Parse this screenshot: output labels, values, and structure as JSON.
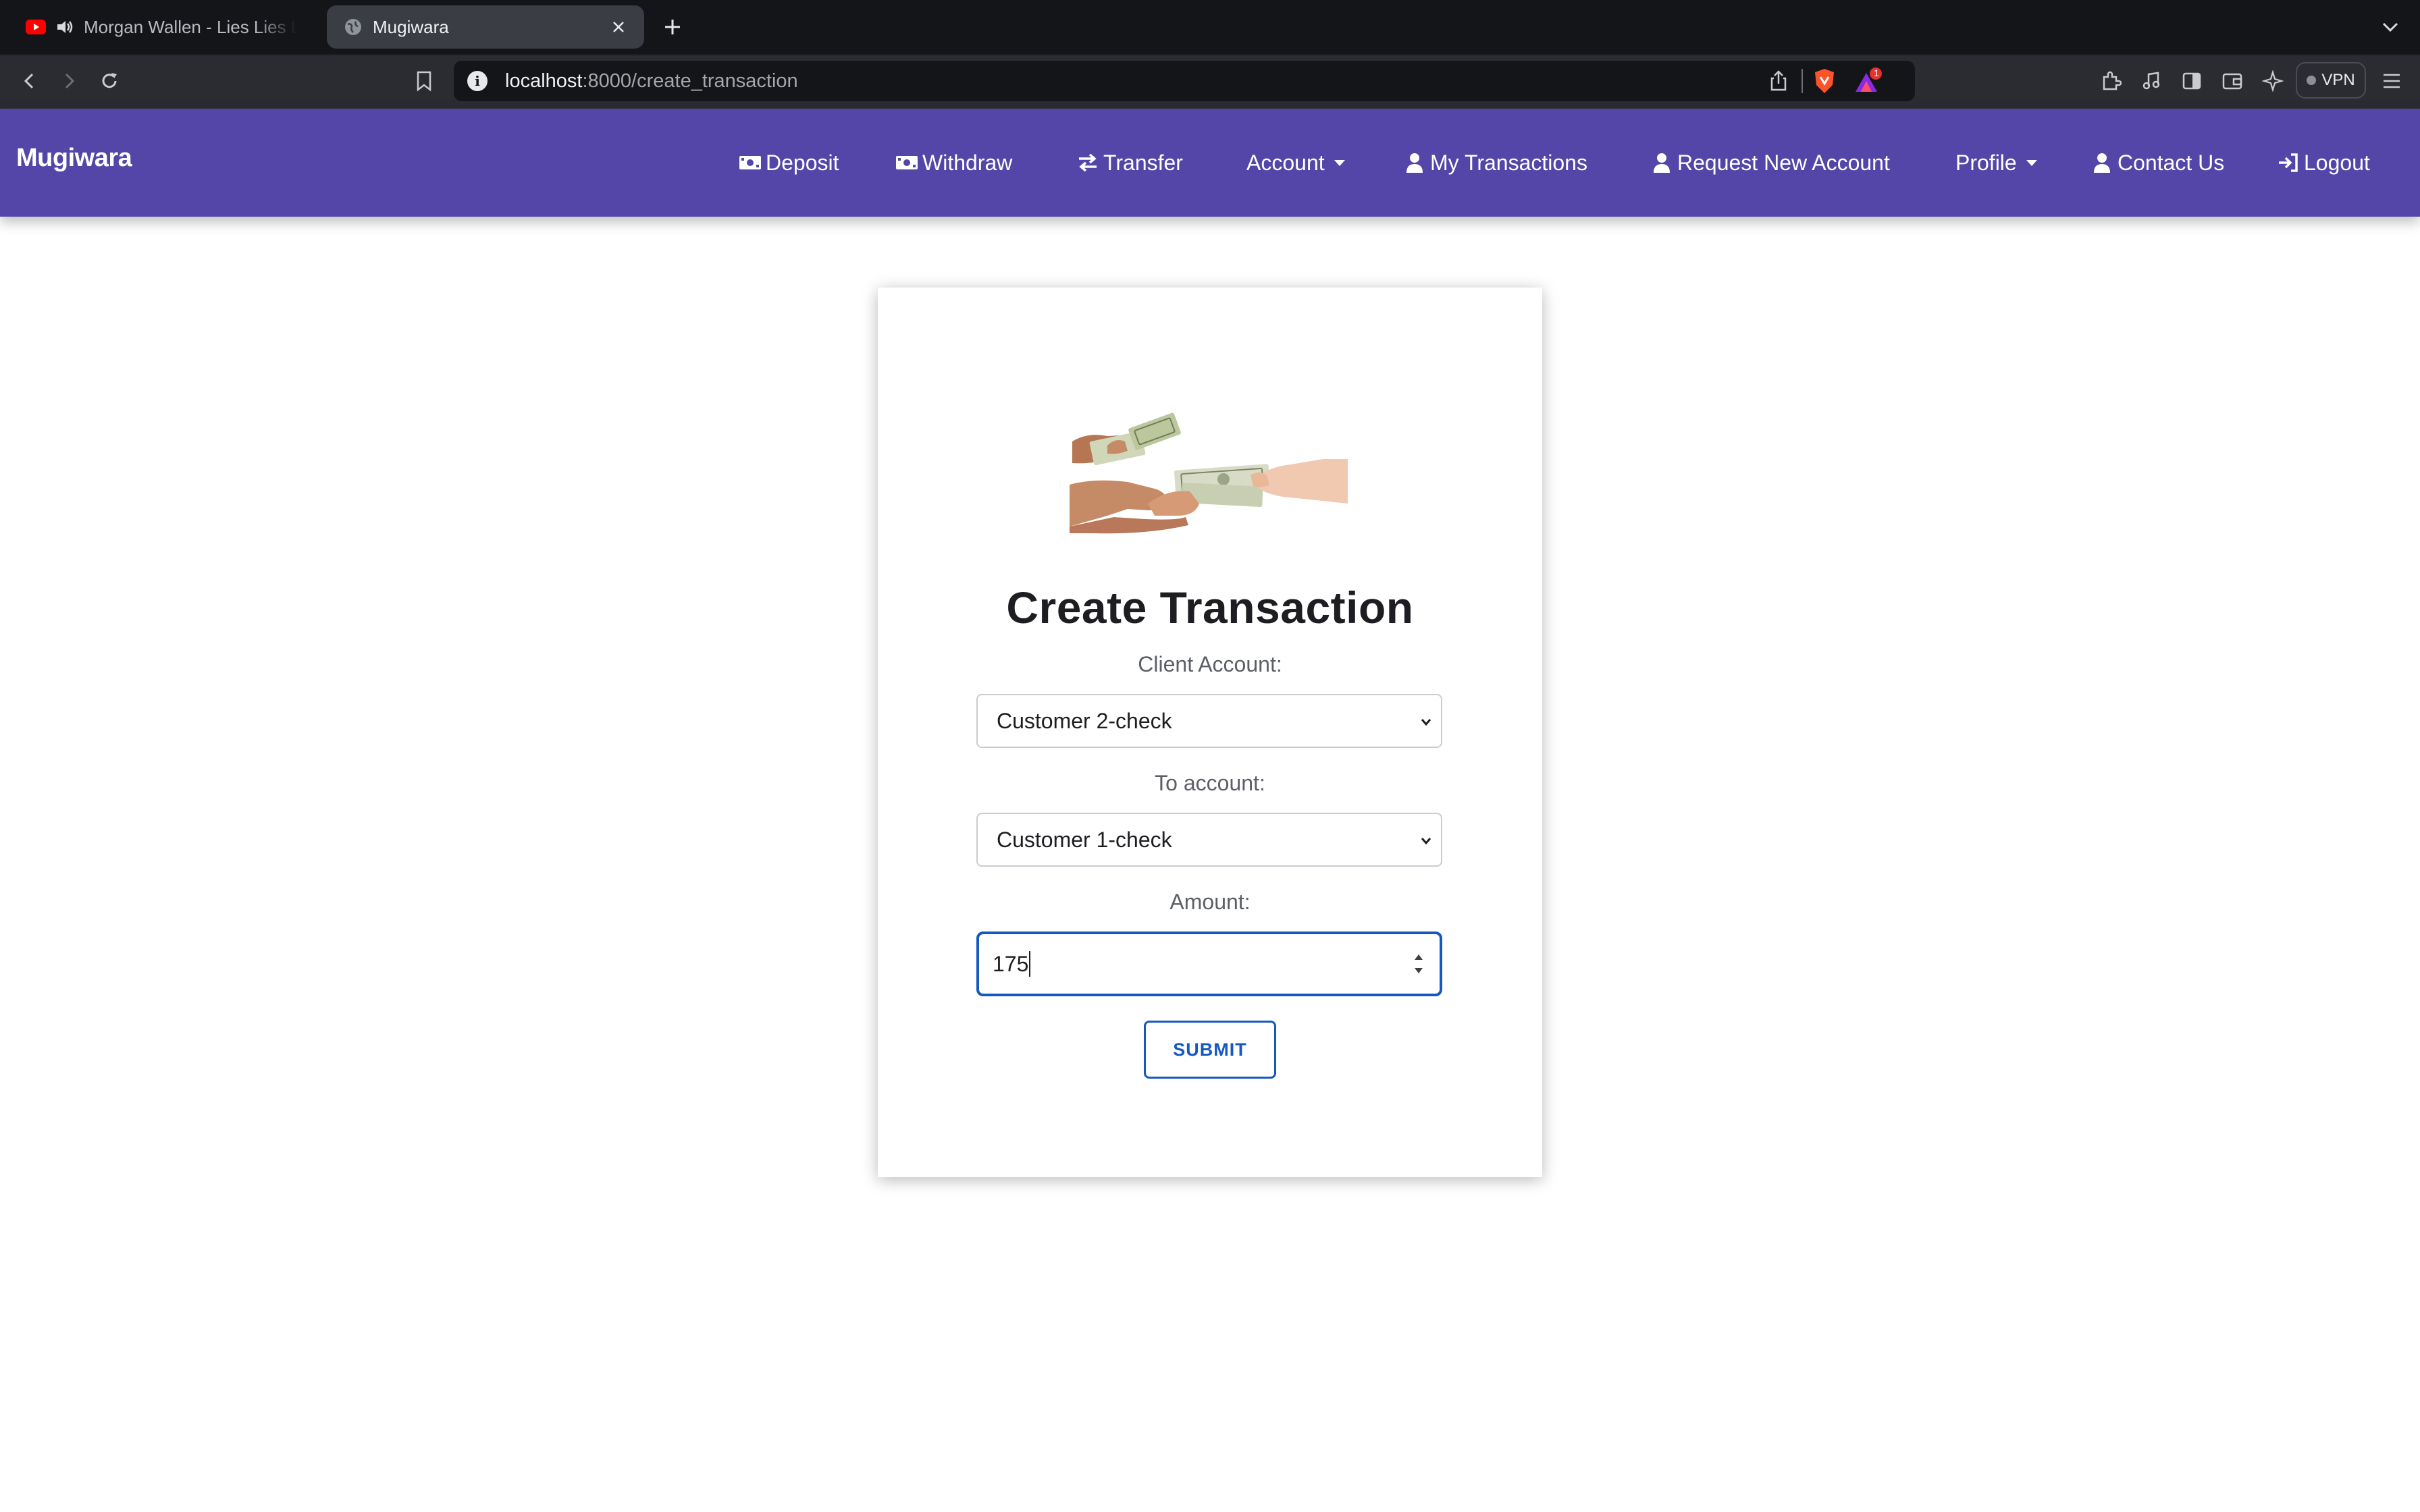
{
  "browser": {
    "tabs": [
      {
        "title": "Morgan Wallen - Lies Lies Lies",
        "active": false,
        "icon": "youtube-icon",
        "audio": true
      },
      {
        "title": "Mugiwara",
        "active": true,
        "icon": "globe-icon"
      }
    ],
    "url": {
      "host": "localhost",
      "path": ":8000/create_transaction"
    },
    "vpn_label": "VPN",
    "notification_count": "1"
  },
  "navbar": {
    "brand": "Mugiwara",
    "bg_color": "#5446a8",
    "items": [
      {
        "label": "Deposit",
        "icon": "money-bill-icon"
      },
      {
        "label": "Withdraw",
        "icon": "money-bill-icon"
      },
      {
        "label": "Transfer",
        "icon": "exchange-arrows-icon"
      },
      {
        "label": "Account",
        "dropdown": true
      },
      {
        "label": "My Transactions",
        "icon": "user-icon"
      },
      {
        "label": "Request New Account",
        "icon": "user-icon"
      },
      {
        "label": "Profile",
        "dropdown": true
      },
      {
        "label": "Contact Us",
        "icon": "user-icon"
      },
      {
        "label": "Logout",
        "icon": "sign-in-icon"
      }
    ]
  },
  "form": {
    "title": "Create Transaction",
    "client_account_label": "Client Account:",
    "client_account_value": "Customer 2-check",
    "to_account_label": "To account:",
    "to_account_value": "Customer 1-check",
    "amount_label": "Amount:",
    "amount_value": "175",
    "submit_label": "SUBMIT",
    "accent_color": "#1558c2"
  }
}
